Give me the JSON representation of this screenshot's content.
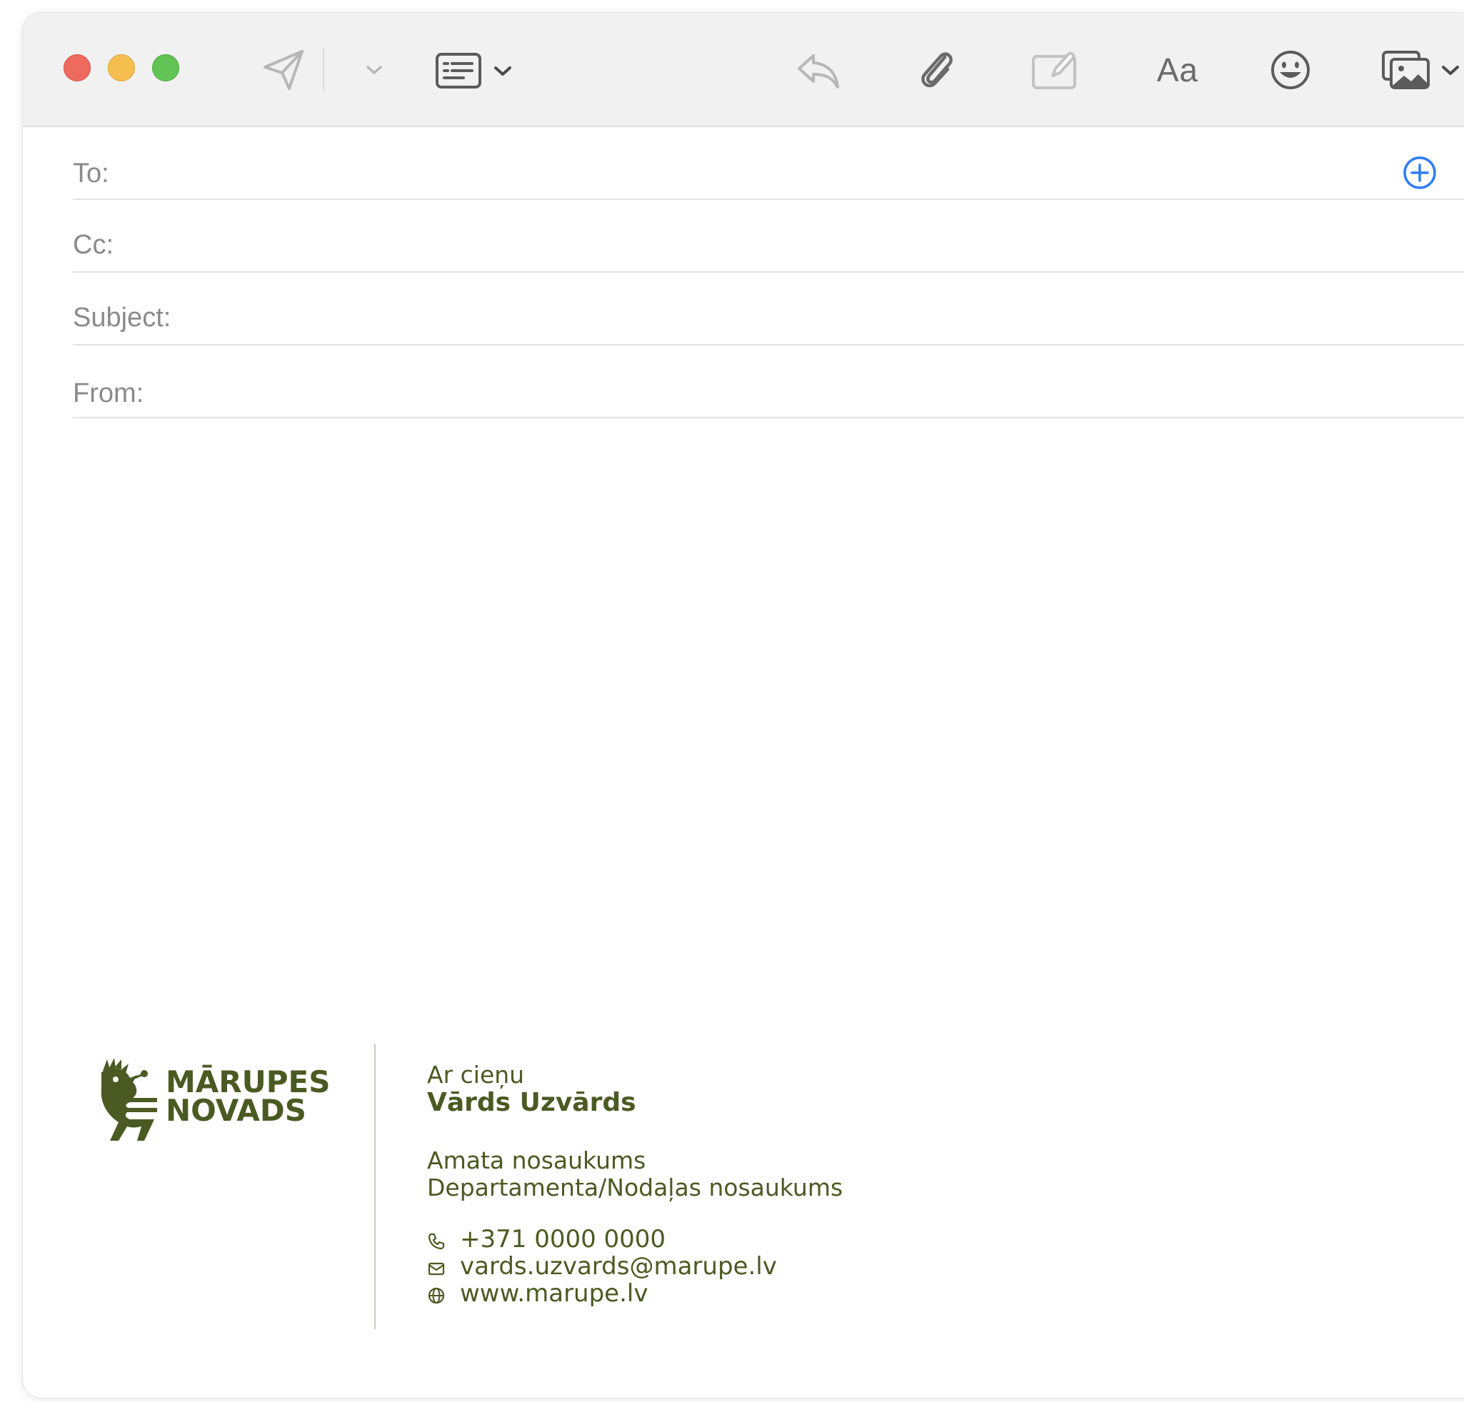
{
  "window": {
    "traffic_lights": [
      "close",
      "minimize",
      "maximize"
    ],
    "colors": {
      "close": "#ee6a5f",
      "minimize": "#f5be4f",
      "maximize": "#61c454"
    }
  },
  "toolbar": {
    "icons": [
      "send-icon",
      "send-options-chevron-icon",
      "header-fields-icon",
      "header-fields-chevron-icon",
      "reply-icon",
      "paperclip-icon",
      "markup-icon",
      "format-icon",
      "emoji-icon",
      "photo-browser-icon",
      "photo-browser-chevron-icon"
    ],
    "format_label": "Aa"
  },
  "fields": {
    "to_label": "To:",
    "cc_label": "Cc:",
    "subject_label": "Subject:",
    "from_label": "From:",
    "add_contact_color": "#2f7cf6"
  },
  "signature": {
    "logo_line1": "MĀRUPES",
    "logo_line2": "NOVADS",
    "greeting": "Ar cieņu",
    "name": "Vārds Uzvārds",
    "role": "Amata nosaukums",
    "department": "Departamenta/Nodaļas nosaukums",
    "phone": "+371 0000 0000",
    "email": "vards.uzvards@marupe.lv",
    "website": "www.marupe.lv",
    "brand_color": "#4b5a22"
  }
}
